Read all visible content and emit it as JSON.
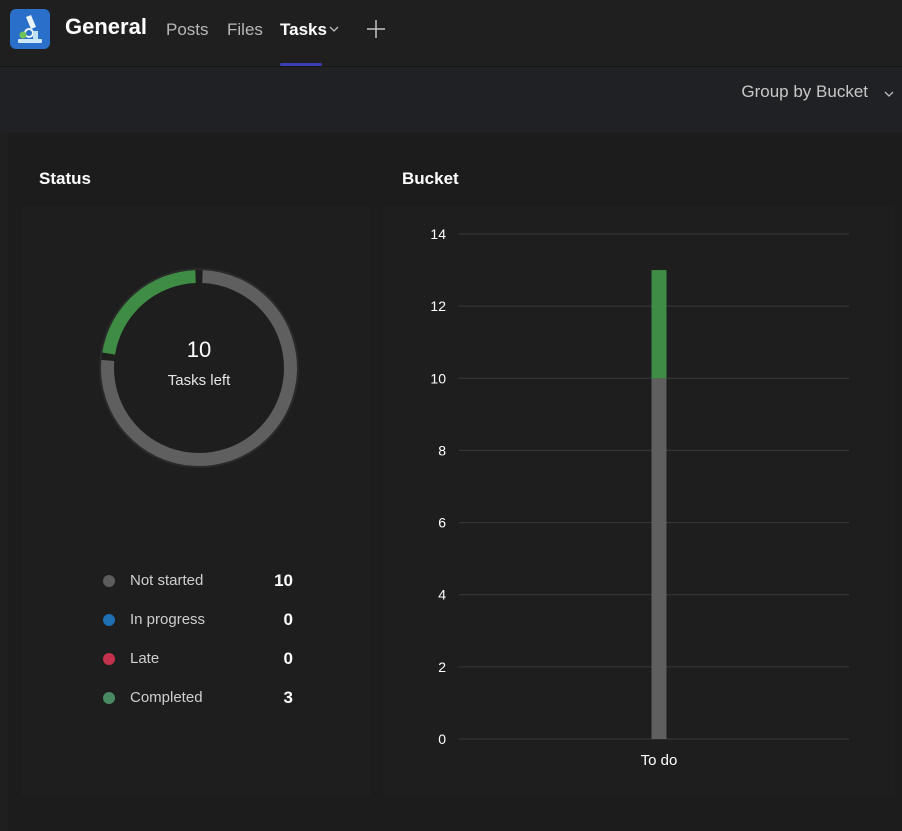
{
  "header": {
    "channel_title": "General",
    "tabs": [
      {
        "label": "Posts",
        "active": false
      },
      {
        "label": "Files",
        "active": false
      },
      {
        "label": "Tasks",
        "active": true
      }
    ]
  },
  "toolbar": {
    "group_by_label": "Group by Bucket"
  },
  "status_panel": {
    "title": "Status",
    "donut_value": "10",
    "donut_label": "Tasks left",
    "legend": [
      {
        "label": "Not started",
        "value": "10",
        "color": "#5c5c5c"
      },
      {
        "label": "In progress",
        "value": "0",
        "color": "#1f6fb5"
      },
      {
        "label": "Late",
        "value": "0",
        "color": "#c4314b"
      },
      {
        "label": "Completed",
        "value": "3",
        "color": "#4a8a63"
      }
    ]
  },
  "bucket_panel": {
    "title": "Bucket"
  },
  "chart_data": [
    {
      "type": "pie",
      "subtype": "donut",
      "center_text": "10",
      "center_label": "Tasks left",
      "slices": [
        {
          "label": "Not started",
          "value": 10,
          "color": "#5f5f5f"
        },
        {
          "label": "Completed",
          "value": 3,
          "color": "#3f8c45"
        }
      ]
    },
    {
      "type": "bar",
      "stacked": true,
      "title": "Bucket",
      "categories": [
        "To do"
      ],
      "series": [
        {
          "values": [
            10
          ],
          "color": "#5f5f5f"
        },
        {
          "values": [
            3
          ],
          "color": "#3f8c45"
        }
      ],
      "ylim": [
        0,
        14
      ],
      "yticks": [
        0,
        2,
        4,
        6,
        8,
        10,
        12,
        14
      ],
      "grid": true
    }
  ]
}
